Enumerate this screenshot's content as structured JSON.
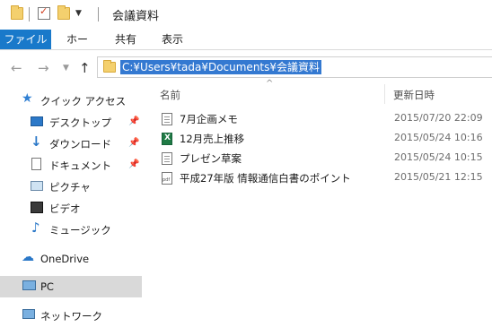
{
  "window": {
    "title": "会議資料"
  },
  "ribbon": {
    "tabs": [
      {
        "label": "ファイル"
      },
      {
        "label": "ホーム"
      },
      {
        "label": "共有"
      },
      {
        "label": "表示"
      }
    ]
  },
  "address": {
    "path": "C:¥Users¥tada¥Documents¥会議資料"
  },
  "sidebar": {
    "quick_access": "クイック アクセス",
    "items": [
      {
        "label": "デスクトップ",
        "icon": "desktop-icon",
        "pinned": true
      },
      {
        "label": "ダウンロード",
        "icon": "download-icon",
        "pinned": true
      },
      {
        "label": "ドキュメント",
        "icon": "documents-icon",
        "pinned": true
      },
      {
        "label": "ピクチャ",
        "icon": "pictures-icon",
        "pinned": false
      },
      {
        "label": "ビデオ",
        "icon": "videos-icon",
        "pinned": false
      },
      {
        "label": "ミュージック",
        "icon": "music-icon",
        "pinned": false
      }
    ],
    "onedrive": "OneDrive",
    "pc": "PC",
    "network": "ネットワーク"
  },
  "file_list": {
    "columns": {
      "name": "名前",
      "modified": "更新日時"
    },
    "rows": [
      {
        "name": "7月企画メモ",
        "modified": "2015/07/20 22:09",
        "icon": "text-file-icon"
      },
      {
        "name": "12月売上推移",
        "modified": "2015/05/24 10:16",
        "icon": "excel-file-icon"
      },
      {
        "name": "プレゼン草案",
        "modified": "2015/05/24 10:15",
        "icon": "text-file-icon"
      },
      {
        "name": "平成27年版 情報通信白書のポイント",
        "modified": "2015/05/21 12:15",
        "icon": "pdf-file-icon"
      }
    ]
  },
  "colors": {
    "file_tab": "#1979ca",
    "selection": "#3479d1",
    "sidebar_selected": "#d9d9d9"
  }
}
